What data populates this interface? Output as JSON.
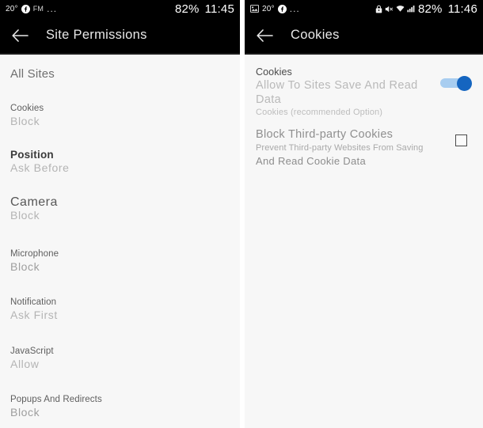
{
  "left_screen": {
    "statusbar": {
      "temperature": "20°",
      "facebook_icon": "facebook-icon",
      "fm_label": "FM",
      "overflow": "...",
      "battery_percent": "82%",
      "time": "11:45"
    },
    "appbar": {
      "back_icon": "back-arrow-icon",
      "title": "Site Permissions"
    },
    "section_title": "All Sites",
    "items": [
      {
        "name": "Cookies",
        "value": "Block"
      },
      {
        "name": "Position",
        "value": "Ask Before"
      },
      {
        "name": "Camera",
        "value": "Block"
      },
      {
        "name": "Microphone",
        "value": "Block"
      },
      {
        "name": "Notification",
        "value": "Ask First"
      },
      {
        "name": "JavaScript",
        "value": "Allow"
      },
      {
        "name": "Popups And Redirects",
        "value": "Block"
      }
    ]
  },
  "right_screen": {
    "statusbar": {
      "image_icon": "photo-icon",
      "temperature": "20°",
      "facebook_icon": "facebook-icon",
      "overflow": "...",
      "lock_icon": "lock-icon",
      "mute_icon": "volume-mute-icon",
      "wifi_icon": "wifi-icon",
      "signal_icon": "cellular-signal-icon",
      "battery_percent": "82%",
      "time": "11:46"
    },
    "appbar": {
      "back_icon": "back-arrow-icon",
      "title": "Cookies"
    },
    "options": [
      {
        "head": "Cookies",
        "main": "Allow To Sites Save And Read Data",
        "sub": "Cookies (recommended Option)",
        "control": "toggle",
        "state": "on"
      },
      {
        "head": "Block Third-party Cookies",
        "sub_line1": "Prevent Third-party Websites From Saving",
        "sub_line2": "And Read Cookie Data",
        "control": "checkbox",
        "state": "off"
      }
    ]
  },
  "colors": {
    "statusbar_bg": "#000000",
    "appbar_bg": "#000000",
    "content_bg": "#f7f7f7",
    "toggle_on_thumb": "#1565c0",
    "toggle_on_track": "#a8cdf0",
    "checkbox_border": "#4b4b4b"
  }
}
